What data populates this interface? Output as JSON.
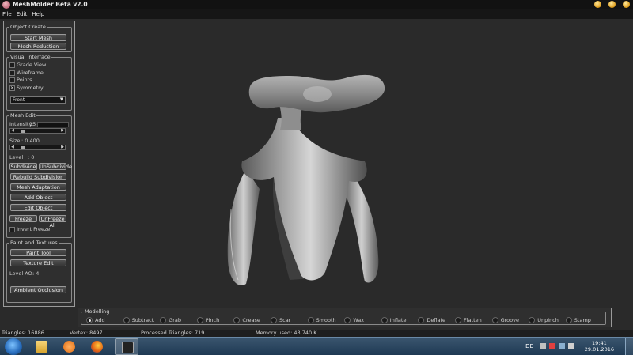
{
  "window": {
    "title": "MeshMolder Beta v2.0"
  },
  "menu": [
    "File",
    "Edit",
    "Help"
  ],
  "object_create": {
    "title": "Object Create",
    "start_mesh": "Start Mesh",
    "mesh_reduction": "Mesh Reduction"
  },
  "visual_interface": {
    "title": "Visual Interface",
    "grade_view": "Grade View",
    "wireframe": "Wireframe",
    "points": "Points",
    "symmetry": "Symmetry",
    "symmetry_checked": true,
    "view": "Front"
  },
  "mesh_edit": {
    "title": "Mesh Edit",
    "intensity_label": "Intensity:",
    "intensity_value": "15",
    "size_label": "Size",
    "size_value": ": 0.400",
    "level_label": "Level",
    "level_value": ": 0",
    "subdivide": "Subdivide",
    "unsubdivide": "UnSubdivide",
    "rebuild_subdivision": "Rebuild Subdivision",
    "mesh_adaptation": "Mesh Adaptation",
    "add_object": "Add Object",
    "edit_object": "Edit Object",
    "freeze": "Freeze",
    "unfreeze_all": "UnFreeze All",
    "invert_freeze": "Invert Freeze"
  },
  "paint": {
    "title": "Paint and Textures",
    "paint_tool": "Paint Tool",
    "texture_edit": "Texture Edit",
    "level_ao_label": "Level AO",
    "level_ao_value": ": 4",
    "ambient_occlusion": "Ambient Occlusion"
  },
  "modelling": {
    "title": "Modelling",
    "modes": [
      "Add",
      "Subtract",
      "Grab",
      "Pinch",
      "Crease",
      "Scar",
      "Smooth",
      "Wax",
      "Inflate",
      "Deflate",
      "Flatten",
      "Groove",
      "Unpinch",
      "Stamp"
    ],
    "selected": "Add"
  },
  "status": {
    "triangles": "Triangles: 16886",
    "vertex": "Vertex: 8497",
    "processed": "Processed Triangles: 719",
    "memory": "Memory used: 43.740 K"
  },
  "taskbar": {
    "lang": "DE",
    "time": "19:41",
    "date": "29.01.2016"
  }
}
